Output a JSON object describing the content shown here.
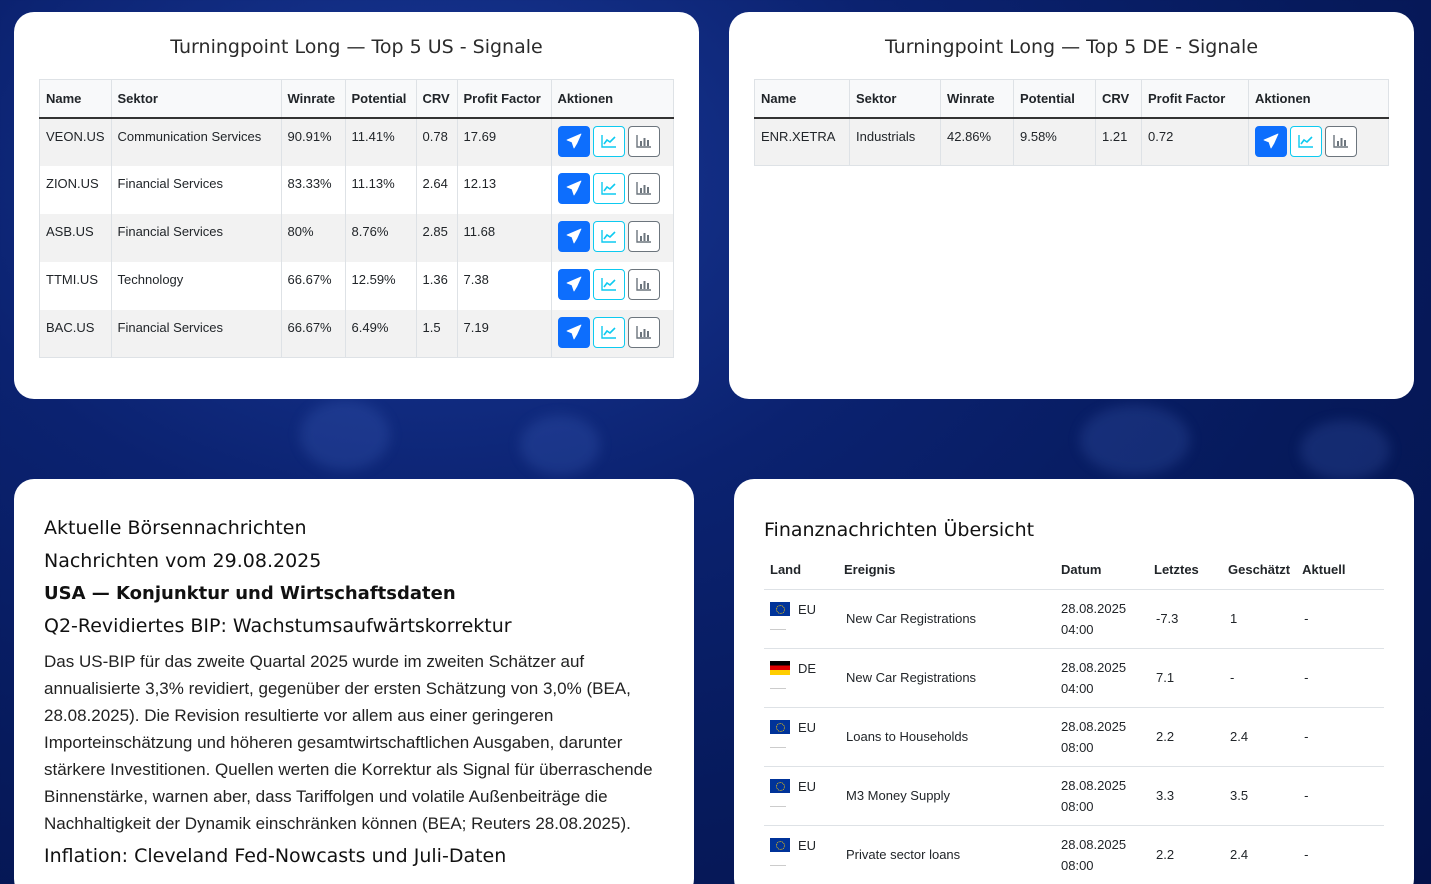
{
  "us_card": {
    "title": "Turningpoint Long — Top 5 US - Signale",
    "headers": [
      "Name",
      "Sektor",
      "Winrate",
      "Potential",
      "CRV",
      "Profit Factor",
      "Aktionen"
    ],
    "rows": [
      {
        "name": "VEON.US",
        "sector": "Communication Services",
        "winrate": "90.91%",
        "potential": "11.41%",
        "crv": "0.78",
        "pf": "17.69"
      },
      {
        "name": "ZION.US",
        "sector": "Financial Services",
        "winrate": "83.33%",
        "potential": "11.13%",
        "crv": "2.64",
        "pf": "12.13"
      },
      {
        "name": "ASB.US",
        "sector": "Financial Services",
        "winrate": "80%",
        "potential": "8.76%",
        "crv": "2.85",
        "pf": "11.68"
      },
      {
        "name": "TTMI.US",
        "sector": "Technology",
        "winrate": "66.67%",
        "potential": "12.59%",
        "crv": "1.36",
        "pf": "7.38"
      },
      {
        "name": "BAC.US",
        "sector": "Financial Services",
        "winrate": "66.67%",
        "potential": "6.49%",
        "crv": "1.5",
        "pf": "7.19"
      }
    ]
  },
  "de_card": {
    "title": "Turningpoint Long — Top 5 DE - Signale",
    "headers": [
      "Name",
      "Sektor",
      "Winrate",
      "Potential",
      "CRV",
      "Profit Factor",
      "Aktionen"
    ],
    "rows": [
      {
        "name": "ENR.XETRA",
        "sector": "Industrials",
        "winrate": "42.86%",
        "potential": "9.58%",
        "crv": "1.21",
        "pf": "0.72"
      }
    ]
  },
  "icons": {
    "telegram": "telegram-icon",
    "chart": "chart-line-icon",
    "stats": "bar-chart-icon"
  },
  "colors": {
    "telegram_btn": "#0d6efd",
    "chart_btn_border": "#0dcaf0",
    "stats_btn_border": "#6c757d"
  },
  "news": {
    "heading": "Aktuelle Börsennachrichten",
    "date_heading": "Nachrichten vom 29.08.2025",
    "section": "USA — Konjunktur und Wirtschaftsdaten",
    "sub1": "Q2-Revidiertes BIP: Wachstumsaufwärtskorrektur",
    "para1": "Das US-BIP für das zweite Quartal 2025 wurde im zweiten Schätzer auf annualisierte 3,3% revidiert, gegenüber der ersten Schätzung von 3,0% (BEA, 28.08.2025). Die Revision resultierte vor allem aus einer geringeren Importeinschätzung und höheren gesamtwirtschaftlichen Ausgaben, darunter stärkere Investitionen. Quellen werten die Korrektur als Signal für überraschende Binnenstärke, warnen aber, dass Tariffolgen und volatile Außenbeiträge die Nachhaltigkeit der Dynamik einschränken können (BEA; Reuters 28.08.2025).",
    "sub2": "Inflation: Cleveland Fed-Nowcasts und Juli-Daten"
  },
  "finance": {
    "title": "Finanznachrichten Übersicht",
    "headers": [
      "Land",
      "Ereignis",
      "Datum",
      "Letztes",
      "Geschätzt",
      "Aktuell"
    ],
    "rows": [
      {
        "flag": "eu",
        "land": "EU",
        "event": "New Car Registrations",
        "date": "28.08.2025",
        "time": "04:00",
        "last": "-7.3",
        "est": "1",
        "actual": "-"
      },
      {
        "flag": "de",
        "land": "DE",
        "event": "New Car Registrations",
        "date": "28.08.2025",
        "time": "04:00",
        "last": "7.1",
        "est": "-",
        "actual": "-"
      },
      {
        "flag": "eu",
        "land": "EU",
        "event": "Loans to Households",
        "date": "28.08.2025",
        "time": "08:00",
        "last": "2.2",
        "est": "2.4",
        "actual": "-"
      },
      {
        "flag": "eu",
        "land": "EU",
        "event": "M3 Money Supply",
        "date": "28.08.2025",
        "time": "08:00",
        "last": "3.3",
        "est": "3.5",
        "actual": "-"
      },
      {
        "flag": "eu",
        "land": "EU",
        "event": "Private sector loans",
        "date": "28.08.2025",
        "time": "08:00",
        "last": "2.2",
        "est": "2.4",
        "actual": "-"
      }
    ]
  }
}
